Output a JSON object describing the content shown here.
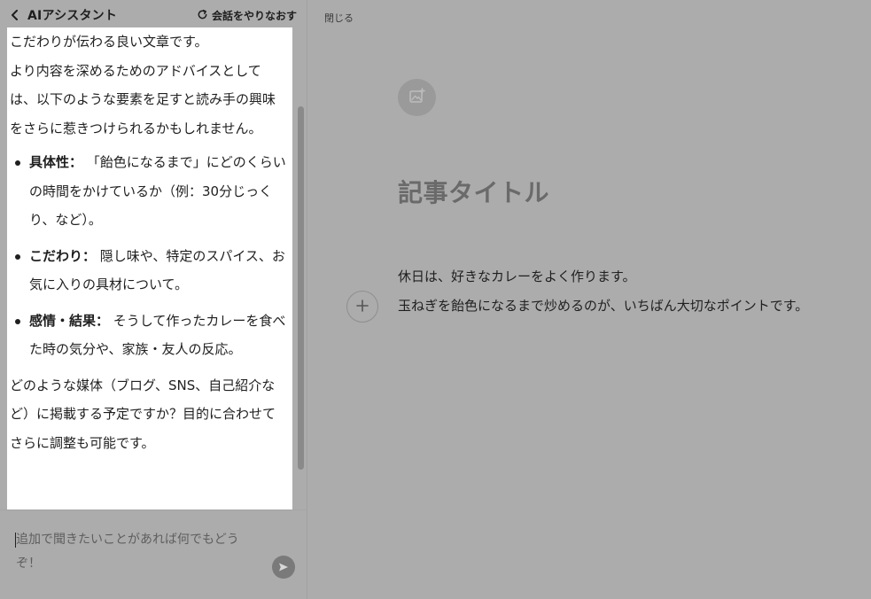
{
  "header": {
    "title": "AIアシスタント",
    "restart_label": "会話をやりなおす"
  },
  "chat": {
    "intro": "こだわりが伝わる良い文章です。",
    "lead": "より内容を深めるためのアドバイスとしては、以下のような要素を足すと読み手の興味をさらに惹きつけられるかもしれません。",
    "bullets": [
      {
        "term": "具体性：",
        "text": "「飴色になるまで」にどのくらいの時間をかけているか（例：30分じっくり、など）。"
      },
      {
        "term": "こだわり：",
        "text": "隠し味や、特定のスパイス、お気に入りの具材について。"
      },
      {
        "term": "感情・結果：",
        "text": "そうして作ったカレーを食べた時の気分や、家族・友人の反応。"
      }
    ],
    "closing": "どのような媒体（ブログ、SNS、自己紹介など）に掲載する予定ですか？目的に合わせてさらに調整も可能です。"
  },
  "input": {
    "placeholder": "追加で聞きたいことがあれば何でもどうぞ！"
  },
  "editor": {
    "close_label": "閉じる",
    "title": "記事タイトル",
    "paragraphs": [
      "休日は、好きなカレーをよく作ります。",
      "玉ねぎを飴色になるまで炒めるのが、いちばん大切なポイントです。"
    ]
  },
  "icons": {
    "back": "chevron-left-icon",
    "restart": "refresh-icon",
    "send": "send-icon",
    "add_image": "add-image-icon",
    "add_block": "plus-icon"
  },
  "colors": {
    "overlay_background": "#acacac",
    "chat_background": "#ffffff",
    "title_text": "#6a6a6a"
  }
}
